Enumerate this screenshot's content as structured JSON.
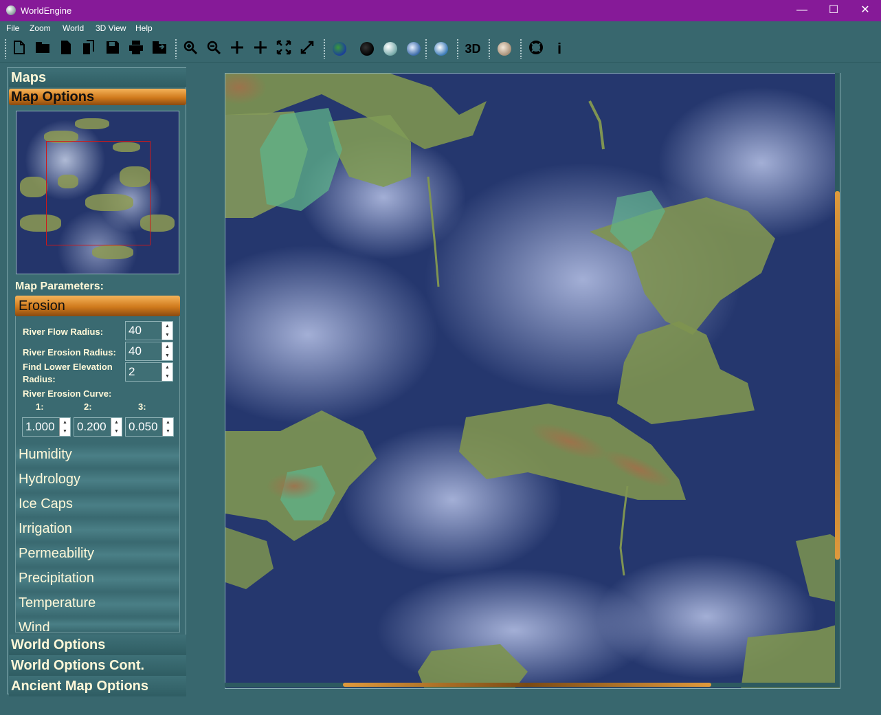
{
  "window": {
    "title": "WorldEngine",
    "minimize": "—",
    "maximize": "☐",
    "close": "✕"
  },
  "menu": [
    "File",
    "Zoom",
    "World",
    "3D View",
    "Help"
  ],
  "toolbar": {
    "label_3d": "3D",
    "info_glyph": "i"
  },
  "panel": {
    "maps": "Maps",
    "map_options": "Map Options",
    "map_parameters": "Map Parameters:",
    "erosion": {
      "title": "Erosion",
      "river_flow_radius_label": "River Flow Radius:",
      "river_flow_radius": "40",
      "river_erosion_radius_label": "River Erosion Radius:",
      "river_erosion_radius": "40",
      "find_lower_label_1": "Find Lower Elevation",
      "find_lower_label_2": "Radius:",
      "find_lower_radius": "2",
      "curve_label": "River Erosion Curve:",
      "curve_headers": [
        "1:",
        "2:",
        "3:"
      ],
      "curve_values": [
        "1.000",
        "0.200",
        "0.050"
      ]
    },
    "categories": [
      "Humidity",
      "Hydrology",
      "Ice Caps",
      "Irrigation",
      "Permeability",
      "Precipitation",
      "Temperature",
      "Wind"
    ],
    "world_options": "World Options",
    "world_options_cont": "World Options Cont.",
    "ancient_map_options": "Ancient Map Options"
  },
  "colors": {
    "titlebar": "#861a98",
    "accent": "#d07a1c",
    "ocean": "#2a3b74",
    "land": "#7e9450"
  }
}
